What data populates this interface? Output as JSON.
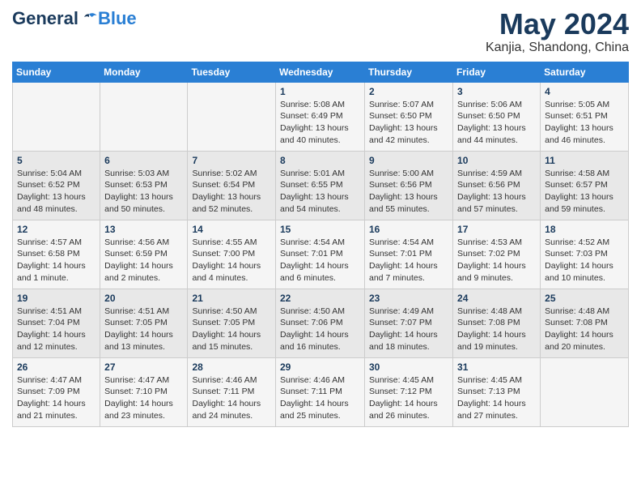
{
  "logo": {
    "general": "General",
    "blue": "Blue"
  },
  "title": "May 2024",
  "location": "Kanjia, Shandong, China",
  "days_of_week": [
    "Sunday",
    "Monday",
    "Tuesday",
    "Wednesday",
    "Thursday",
    "Friday",
    "Saturday"
  ],
  "weeks": [
    [
      {
        "day": "",
        "info": ""
      },
      {
        "day": "",
        "info": ""
      },
      {
        "day": "",
        "info": ""
      },
      {
        "day": "1",
        "info": "Sunrise: 5:08 AM\nSunset: 6:49 PM\nDaylight: 13 hours\nand 40 minutes."
      },
      {
        "day": "2",
        "info": "Sunrise: 5:07 AM\nSunset: 6:50 PM\nDaylight: 13 hours\nand 42 minutes."
      },
      {
        "day": "3",
        "info": "Sunrise: 5:06 AM\nSunset: 6:50 PM\nDaylight: 13 hours\nand 44 minutes."
      },
      {
        "day": "4",
        "info": "Sunrise: 5:05 AM\nSunset: 6:51 PM\nDaylight: 13 hours\nand 46 minutes."
      }
    ],
    [
      {
        "day": "5",
        "info": "Sunrise: 5:04 AM\nSunset: 6:52 PM\nDaylight: 13 hours\nand 48 minutes."
      },
      {
        "day": "6",
        "info": "Sunrise: 5:03 AM\nSunset: 6:53 PM\nDaylight: 13 hours\nand 50 minutes."
      },
      {
        "day": "7",
        "info": "Sunrise: 5:02 AM\nSunset: 6:54 PM\nDaylight: 13 hours\nand 52 minutes."
      },
      {
        "day": "8",
        "info": "Sunrise: 5:01 AM\nSunset: 6:55 PM\nDaylight: 13 hours\nand 54 minutes."
      },
      {
        "day": "9",
        "info": "Sunrise: 5:00 AM\nSunset: 6:56 PM\nDaylight: 13 hours\nand 55 minutes."
      },
      {
        "day": "10",
        "info": "Sunrise: 4:59 AM\nSunset: 6:56 PM\nDaylight: 13 hours\nand 57 minutes."
      },
      {
        "day": "11",
        "info": "Sunrise: 4:58 AM\nSunset: 6:57 PM\nDaylight: 13 hours\nand 59 minutes."
      }
    ],
    [
      {
        "day": "12",
        "info": "Sunrise: 4:57 AM\nSunset: 6:58 PM\nDaylight: 14 hours\nand 1 minute."
      },
      {
        "day": "13",
        "info": "Sunrise: 4:56 AM\nSunset: 6:59 PM\nDaylight: 14 hours\nand 2 minutes."
      },
      {
        "day": "14",
        "info": "Sunrise: 4:55 AM\nSunset: 7:00 PM\nDaylight: 14 hours\nand 4 minutes."
      },
      {
        "day": "15",
        "info": "Sunrise: 4:54 AM\nSunset: 7:01 PM\nDaylight: 14 hours\nand 6 minutes."
      },
      {
        "day": "16",
        "info": "Sunrise: 4:54 AM\nSunset: 7:01 PM\nDaylight: 14 hours\nand 7 minutes."
      },
      {
        "day": "17",
        "info": "Sunrise: 4:53 AM\nSunset: 7:02 PM\nDaylight: 14 hours\nand 9 minutes."
      },
      {
        "day": "18",
        "info": "Sunrise: 4:52 AM\nSunset: 7:03 PM\nDaylight: 14 hours\nand 10 minutes."
      }
    ],
    [
      {
        "day": "19",
        "info": "Sunrise: 4:51 AM\nSunset: 7:04 PM\nDaylight: 14 hours\nand 12 minutes."
      },
      {
        "day": "20",
        "info": "Sunrise: 4:51 AM\nSunset: 7:05 PM\nDaylight: 14 hours\nand 13 minutes."
      },
      {
        "day": "21",
        "info": "Sunrise: 4:50 AM\nSunset: 7:05 PM\nDaylight: 14 hours\nand 15 minutes."
      },
      {
        "day": "22",
        "info": "Sunrise: 4:50 AM\nSunset: 7:06 PM\nDaylight: 14 hours\nand 16 minutes."
      },
      {
        "day": "23",
        "info": "Sunrise: 4:49 AM\nSunset: 7:07 PM\nDaylight: 14 hours\nand 18 minutes."
      },
      {
        "day": "24",
        "info": "Sunrise: 4:48 AM\nSunset: 7:08 PM\nDaylight: 14 hours\nand 19 minutes."
      },
      {
        "day": "25",
        "info": "Sunrise: 4:48 AM\nSunset: 7:08 PM\nDaylight: 14 hours\nand 20 minutes."
      }
    ],
    [
      {
        "day": "26",
        "info": "Sunrise: 4:47 AM\nSunset: 7:09 PM\nDaylight: 14 hours\nand 21 minutes."
      },
      {
        "day": "27",
        "info": "Sunrise: 4:47 AM\nSunset: 7:10 PM\nDaylight: 14 hours\nand 23 minutes."
      },
      {
        "day": "28",
        "info": "Sunrise: 4:46 AM\nSunset: 7:11 PM\nDaylight: 14 hours\nand 24 minutes."
      },
      {
        "day": "29",
        "info": "Sunrise: 4:46 AM\nSunset: 7:11 PM\nDaylight: 14 hours\nand 25 minutes."
      },
      {
        "day": "30",
        "info": "Sunrise: 4:45 AM\nSunset: 7:12 PM\nDaylight: 14 hours\nand 26 minutes."
      },
      {
        "day": "31",
        "info": "Sunrise: 4:45 AM\nSunset: 7:13 PM\nDaylight: 14 hours\nand 27 minutes."
      },
      {
        "day": "",
        "info": ""
      }
    ]
  ]
}
